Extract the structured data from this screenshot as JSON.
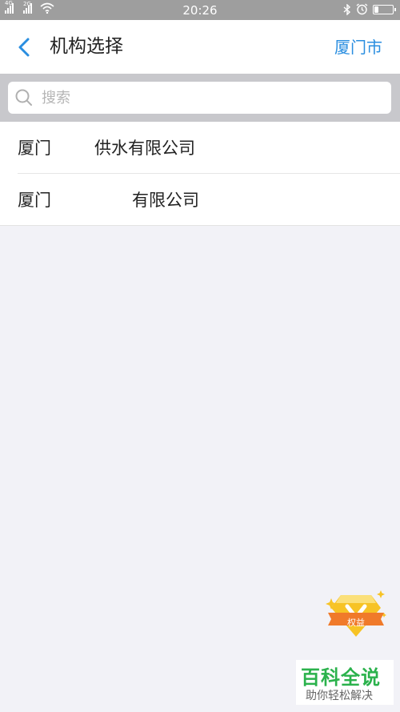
{
  "status_bar": {
    "sim1_label": "4G",
    "sim2_label": "2G",
    "time": "20:26",
    "battery_level": 0.25
  },
  "nav": {
    "title": "机构选择",
    "right_label": "厦门市"
  },
  "search": {
    "placeholder": "搜索",
    "value": ""
  },
  "list": {
    "items": [
      {
        "city": "厦门",
        "org": "供水有限公司"
      },
      {
        "city": "厦门",
        "org": "有限公司"
      }
    ]
  },
  "badge": {
    "label": "权益"
  },
  "watermark": {
    "title": "百科全说",
    "subtitle": "助你轻松解决"
  },
  "colors": {
    "accent": "#2a8ee0",
    "status_bar": "#9e9e9e",
    "watermark_green": "#2bb24c",
    "badge_gold": "#f7c325",
    "badge_ribbon": "#f07a2a"
  }
}
